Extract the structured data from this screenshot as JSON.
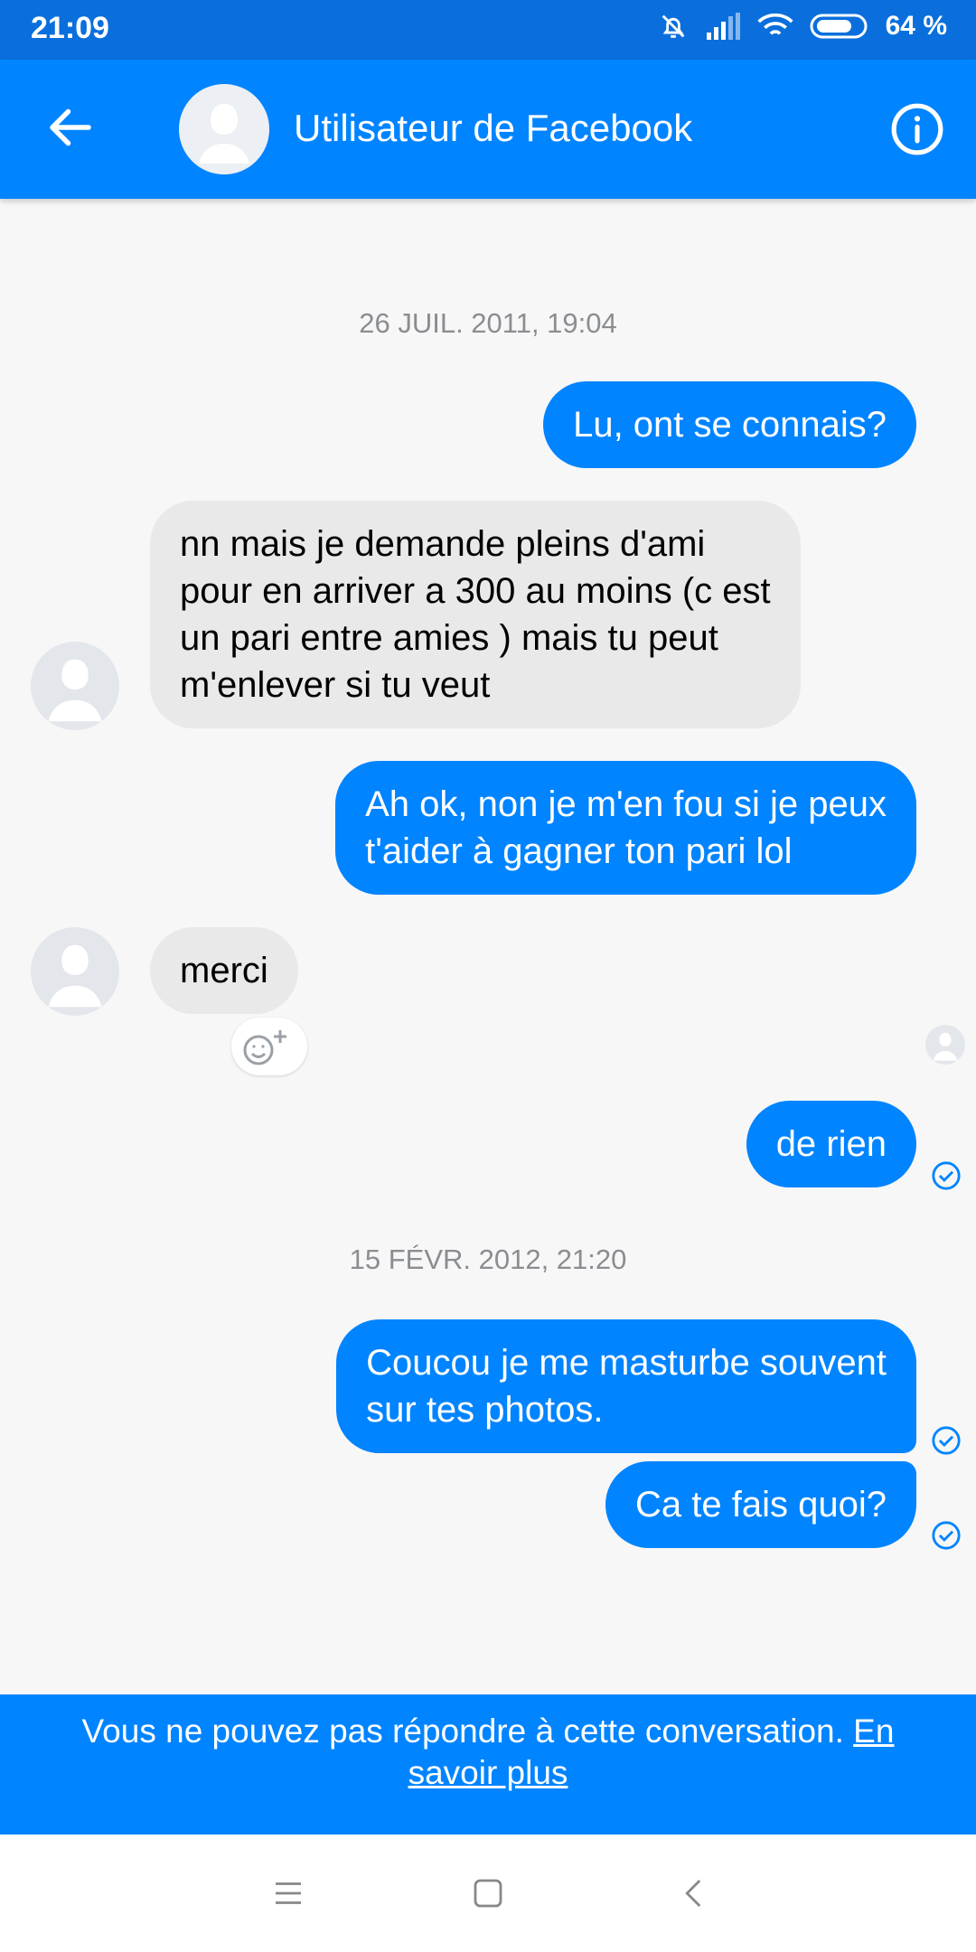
{
  "status_bar": {
    "time": "21:09",
    "battery": "64 %",
    "icons": [
      "bell-muted-icon",
      "signal-icon",
      "wifi-icon",
      "battery-icon"
    ]
  },
  "header": {
    "title": "Utilisateur de Facebook",
    "back_icon": "arrow-back-icon",
    "info_icon": "info-icon"
  },
  "conversation": {
    "timestamp_1": "26 JUIL. 2011, 19:04",
    "msg_1": "Lu, ont se connais?",
    "msg_2_line_1": "nn mais je demande pleins d'ami",
    "msg_2_line_2": "pour en arriver a 300 au moins (c est",
    "msg_2_line_3": "un pari entre amies ) mais tu peut",
    "msg_2_line_4": "m'enlever si tu veut",
    "msg_3_line_1": "Ah ok, non je m'en fou si je peux",
    "msg_3_line_2": "t'aider à gagner ton pari lol",
    "msg_4": "merci",
    "msg_5": "de rien",
    "timestamp_2": "15 FÉVR. 2012, 21:20",
    "msg_6_line_1": "Coucou je me masturbe souvent",
    "msg_6_line_2": "sur tes photos.",
    "msg_7": "Ca te fais quoi?"
  },
  "notice": {
    "text": "Vous ne pouvez pas répondre à cette conversation. ",
    "link": "En savoir plus"
  },
  "colors": {
    "status_bar": "#0a6fdc",
    "accent": "#0084ff",
    "incoming_bubble": "#e9e9e9",
    "background": "#f7f7f7",
    "timestamp": "#8a8d91"
  }
}
